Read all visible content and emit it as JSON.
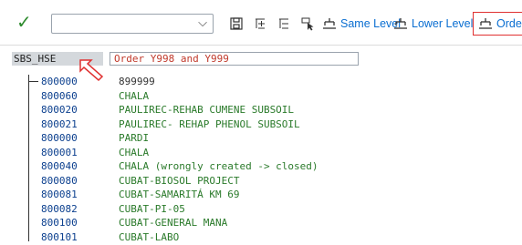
{
  "toolbar": {
    "command_value": "",
    "buttons": [
      {
        "label": "Same Level"
      },
      {
        "label": "Lower Level"
      },
      {
        "label": "Order"
      }
    ]
  },
  "header": {
    "label": "SBS_HSE",
    "value": "Order Y998 and Y999"
  },
  "rows": [
    {
      "code": "800000",
      "desc": "899999"
    },
    {
      "code": "800060",
      "desc": "CHALA"
    },
    {
      "code": "800020",
      "desc": "PAULIREC-REHAB CUMENE SUBSOIL"
    },
    {
      "code": "800021",
      "desc": "PAULIREC- REHAP PHENOL SUBSOIL"
    },
    {
      "code": "800000",
      "desc": "PARDI"
    },
    {
      "code": "800001",
      "desc": "CHALA"
    },
    {
      "code": "800040",
      "desc": "CHALA (wrongly created -> closed)"
    },
    {
      "code": "800080",
      "desc": "CUBAT-BIOSOL PROJECT"
    },
    {
      "code": "800081",
      "desc": "CUBAT-SAMARITÁ KM 69"
    },
    {
      "code": "800082",
      "desc": "CUBAT-PI-05"
    },
    {
      "code": "800100",
      "desc": "CUBAT-GENERAL MANA"
    },
    {
      "code": "800101",
      "desc": "CUBAT-LABO"
    }
  ],
  "colors": {
    "code": "#0b3f8e",
    "desc": "#2a7a2a",
    "accent": "#0a6ed1",
    "highlight_border": "#e03030"
  }
}
